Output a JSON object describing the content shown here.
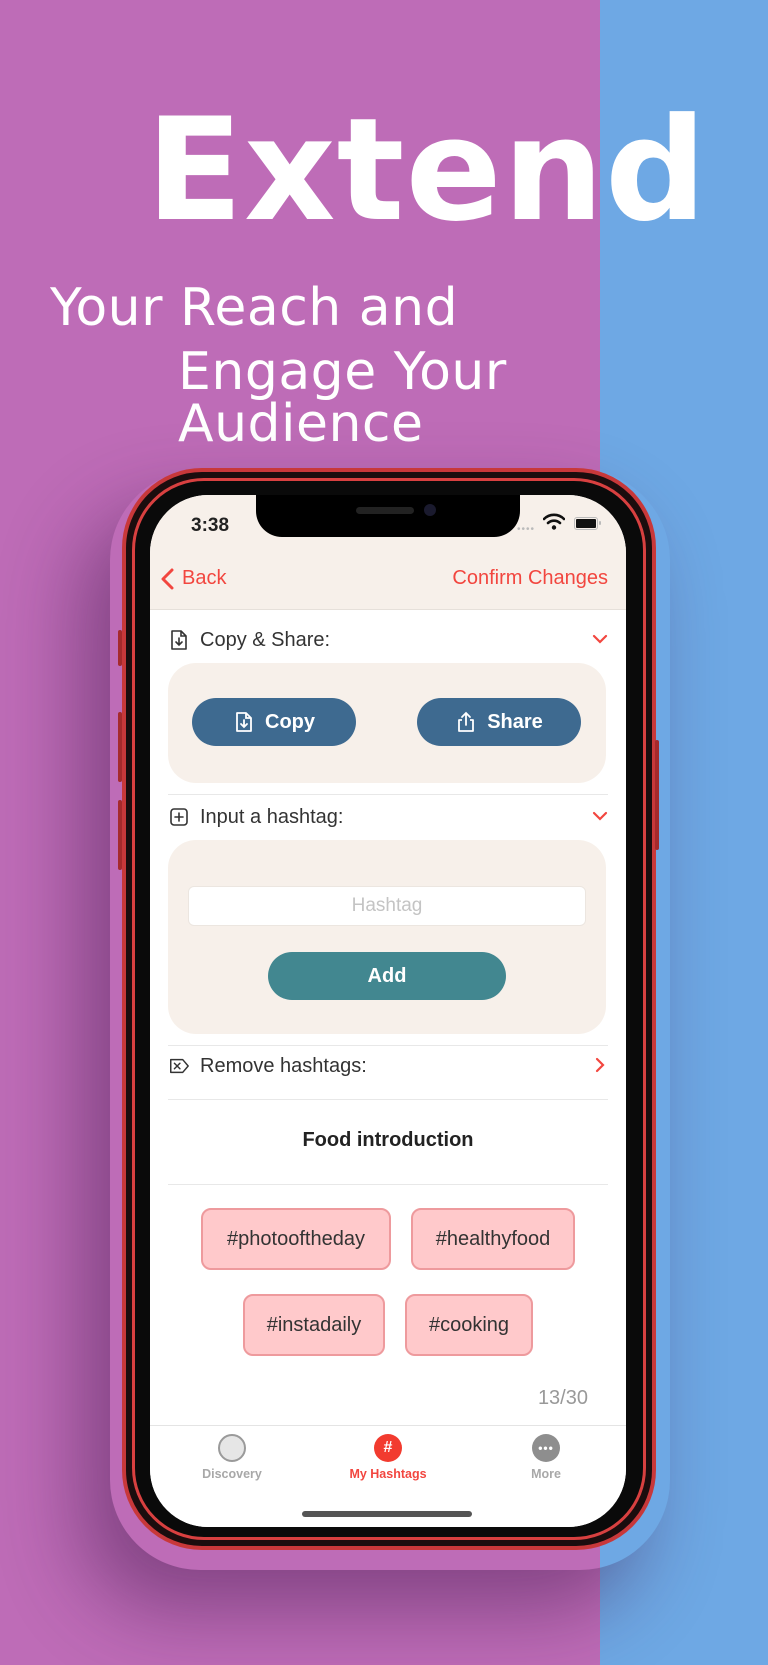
{
  "colors": {
    "bg_left": "#BE6CB7",
    "bg_right": "#6EA8E4",
    "accent": "#F2463F",
    "copy_share_button": "#3E6A90",
    "add_button": "#428790",
    "panel": "#F7F0EA",
    "tag_fill": "#FFC9CB",
    "tag_border": "#EE9A9D"
  },
  "promo": {
    "headline": "Extend",
    "line1": "Your Reach and",
    "line2": "Engage Your Audience"
  },
  "status_bar": {
    "time": "3:38",
    "icons": [
      "signal-icon",
      "wifi-icon",
      "battery-icon"
    ]
  },
  "nav": {
    "back_label": "Back",
    "confirm_label": "Confirm Changes"
  },
  "sections": {
    "copy_share": {
      "title": "Copy & Share:",
      "icon": "document-download-icon",
      "expanded": true,
      "copy_label": "Copy",
      "share_label": "Share"
    },
    "input": {
      "title": "Input a hashtag:",
      "icon": "plus-square-icon",
      "expanded": true,
      "placeholder": "Hashtag",
      "value": "",
      "add_label": "Add"
    },
    "remove": {
      "title": "Remove hashtags:",
      "icon": "delete-tag-icon",
      "expanded": false
    }
  },
  "hashtag_set": {
    "title": "Food introduction",
    "tags": [
      "#photooftheday",
      "#healthyfood",
      "#instadaily",
      "#cooking"
    ],
    "count": "13/30"
  },
  "tabbar": {
    "items": [
      {
        "label": "Discovery",
        "icon": "circle-icon",
        "active": false
      },
      {
        "label": "My Hashtags",
        "icon": "hashtag-icon",
        "active": true
      },
      {
        "label": "More",
        "icon": "more-icon",
        "active": false
      }
    ]
  }
}
